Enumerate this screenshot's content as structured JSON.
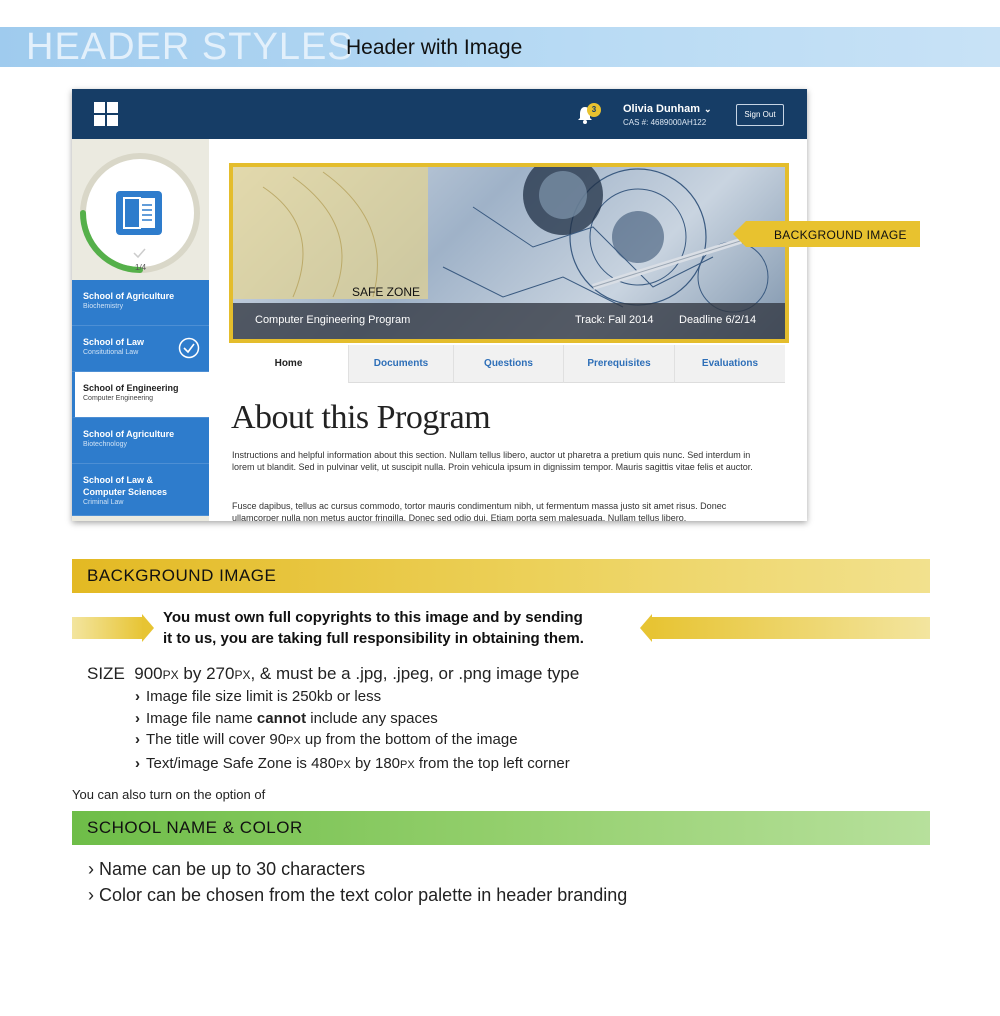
{
  "page_title": "HEADER STYLES",
  "page_subtitle": "Header with Image",
  "mockup": {
    "user_name": "Olivia Dunham",
    "cas_number": "CAS #: 4689000AH122",
    "notification_count": "3",
    "sign_out_label": "Sign Out",
    "progress_label": "1/4",
    "progress_fraction": 0.25,
    "sidebar": [
      {
        "school": "School of Agriculture",
        "program": "Biochemistry",
        "active": false,
        "checked": false
      },
      {
        "school": "School of Law",
        "program": "Consitutional Law",
        "active": false,
        "checked": true
      },
      {
        "school": "School of Engineering",
        "program": "Computer Engineering",
        "active": true,
        "checked": false
      },
      {
        "school": "School of Agriculture",
        "program": "Biotechnology",
        "active": false,
        "checked": false
      },
      {
        "school": "School of Law &",
        "school_line2": "Computer Sciences",
        "program": "Criminal Law",
        "active": false,
        "checked": false
      }
    ],
    "hero": {
      "safe_zone_label": "SAFE ZONE",
      "program": "Computer Engineering Program",
      "track": "Track: Fall 2014",
      "deadline": "Deadline 6/2/14"
    },
    "tabs": [
      {
        "label": "Home",
        "active": true
      },
      {
        "label": "Documents",
        "active": false
      },
      {
        "label": "Questions",
        "active": false
      },
      {
        "label": "Prerequisites",
        "active": false
      },
      {
        "label": "Evaluations",
        "active": false
      }
    ],
    "about_title": "About this Program",
    "para1": "Instructions and helpful information about this section. Nullam tellus libero, auctor ut pharetra a pretium quis nunc. Sed interdum in lorem ut blandit. Sed in pulvinar velit, ut suscipit nulla. Proin vehicula ipsum in dignissim tempor. Mauris sagittis vitae felis et auctor.",
    "para2": "Fusce dapibus, tellus ac cursus commodo, tortor mauris condimentum nibh, ut fermentum massa justo sit amet risus. Donec ullamcorper nulla non metus auctor fringilla. Donec sed odio dui. Etiam porta sem malesuada. Nullam tellus libero."
  },
  "callout_label": "BACKGROUND IMAGE",
  "bg_section": {
    "title": "BACKGROUND IMAGE",
    "copyright_line1": "You must own full copyrights to this image and by sending",
    "copyright_line2": "it to us, you are taking full responsibility in obtaining them.",
    "size_label": "SIZE",
    "size_w": "900",
    "size_unit": "PX",
    "size_by": "by",
    "size_h": "270",
    "size_rest": ", & must be a .jpg, .jpeg, or .png image type",
    "bullet1": "Image file size limit is 250kb or less",
    "bullet2_pre": "Image file name ",
    "bullet2_bold": "cannot",
    "bullet2_post": " include any spaces",
    "bullet3_pre": "The title will cover 90",
    "bullet3_post": " up from the bottom of the image",
    "bullet4_pre": "Text/image Safe Zone is 480",
    "bullet4_mid": " by 180",
    "bullet4_post": " from the top left corner"
  },
  "also_text": "You can also turn on the option of",
  "school_section": {
    "title": "SCHOOL NAME & COLOR",
    "bullet1": "Name can be up to 30 characters",
    "bullet2": "Color can be chosen from the text color palette in header branding"
  },
  "colors": {
    "header_navy": "#163d66",
    "sidebar_blue": "#2e7ccc",
    "accent_yellow": "#e4bd2c",
    "accent_green": "#6ebd48",
    "banner_blue": "#9fcbee"
  },
  "icons": [
    "grid-menu-icon",
    "bell-icon",
    "chevron-down-icon",
    "open-book-icon",
    "checkmark-icon",
    "check-circle-icon",
    "arrow-right-icon",
    "arrow-left-icon"
  ]
}
